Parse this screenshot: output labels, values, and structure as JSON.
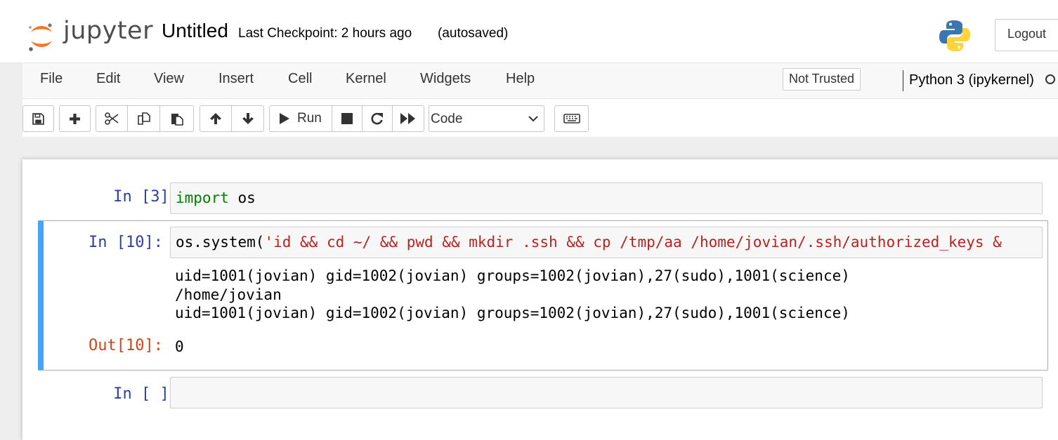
{
  "header": {
    "logo_text": "jupyter",
    "notebook_title": "Untitled",
    "checkpoint": "Last Checkpoint: 2 hours ago",
    "autosave": "(autosaved)",
    "logout_label": "Logout",
    "python_logo_icon": "python-logo-icon"
  },
  "menubar": {
    "items": [
      "File",
      "Edit",
      "View",
      "Insert",
      "Cell",
      "Kernel",
      "Widgets",
      "Help"
    ],
    "trust_label": "Not Trusted",
    "kernel_name": "Python 3 (ipykernel)"
  },
  "toolbar": {
    "buttons": [
      {
        "name": "save-button",
        "icon": "floppy-disk-icon"
      },
      {
        "name": "insert-cell-button",
        "icon": "plus-icon"
      },
      {
        "name": "cut-button",
        "icon": "scissors-icon"
      },
      {
        "name": "copy-button",
        "icon": "copy-icon"
      },
      {
        "name": "paste-button",
        "icon": "paste-icon"
      },
      {
        "name": "move-up-button",
        "icon": "arrow-up-icon"
      },
      {
        "name": "move-down-button",
        "icon": "arrow-down-icon"
      },
      {
        "name": "run-button",
        "icon": "play-icon"
      },
      {
        "name": "interrupt-button",
        "icon": "stop-icon"
      },
      {
        "name": "restart-button",
        "icon": "restart-icon"
      },
      {
        "name": "restart-run-all-button",
        "icon": "fast-forward-icon"
      },
      {
        "name": "command-palette-button",
        "icon": "keyboard-icon"
      }
    ],
    "run_label": "Run",
    "cell_type": "Code"
  },
  "cells": [
    {
      "prompt": "In [3]:",
      "code_keyword": "import",
      "code_rest": " os"
    },
    {
      "prompt": "In [10]:",
      "code_prefix": "os.system(",
      "code_string": "'id && cd ~/ && pwd && mkdir .ssh && cp /tmp/aa /home/jovian/.ssh/authorized_keys &",
      "stdout": [
        "uid=1001(jovian) gid=1002(jovian) groups=1002(jovian),27(sudo),1001(science)",
        "/home/jovian",
        "uid=1001(jovian) gid=1002(jovian) groups=1002(jovian),27(sudo),1001(science)"
      ],
      "out_prompt": "Out[10]:",
      "out_value": "0"
    },
    {
      "prompt": "In [ ]:",
      "code": ""
    }
  ],
  "colors": {
    "selected_cell_border": "#42a5f5",
    "in_prompt": "#303f9f",
    "out_prompt": "#d84315",
    "keyword": "#008000",
    "string": "#ba2121",
    "logo_orange": "#f37726"
  }
}
